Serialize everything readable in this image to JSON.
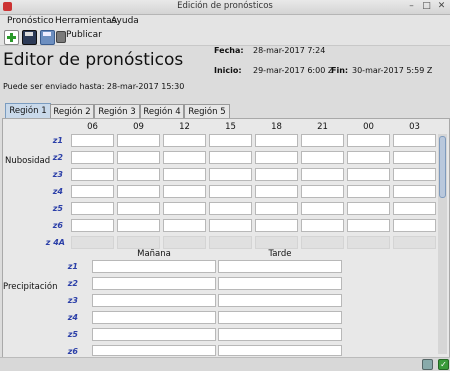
{
  "window": {
    "title": "Edición de pronósticos"
  },
  "menu": {
    "items": [
      "Pronóstico",
      "Herramientas",
      "Ayuda"
    ]
  },
  "toolbar": {
    "publish_label": "Publicar"
  },
  "editor": {
    "title": "Editor de pronósticos",
    "fecha_label": "Fecha:",
    "fecha_value": "28-mar-2017 7:24",
    "inicio_label": "Inicio:",
    "inicio_value": "29-mar-2017 6:00 Z",
    "fin_label": "Fin:",
    "fin_value": "30-mar-2017 5:59 Z",
    "send_until": "Puede ser enviado hasta: 28-mar-2017 15:30"
  },
  "tabs": [
    "Región 1",
    "Región 2",
    "Región 3",
    "Región 4",
    "Región 5"
  ],
  "nubosidad": {
    "label": "Nubosidad",
    "hours": [
      "06",
      "09",
      "12",
      "15",
      "18",
      "21",
      "00",
      "03"
    ],
    "zones": [
      "z1",
      "z2",
      "z3",
      "z4",
      "z5",
      "z6",
      "z 4A"
    ]
  },
  "precipitacion": {
    "label": "Precipitación",
    "columns": [
      "Mañana",
      "Tarde"
    ],
    "zones": [
      "z1",
      "z2",
      "z3",
      "z4",
      "z5",
      "z6"
    ]
  },
  "colors": {
    "accent": "#2b3fa8",
    "tab_active": "#c9d9ea"
  },
  "icons": [
    "new-icon",
    "save-icon",
    "save-as-icon",
    "print-icon",
    "sound-icon",
    "check-icon"
  ]
}
